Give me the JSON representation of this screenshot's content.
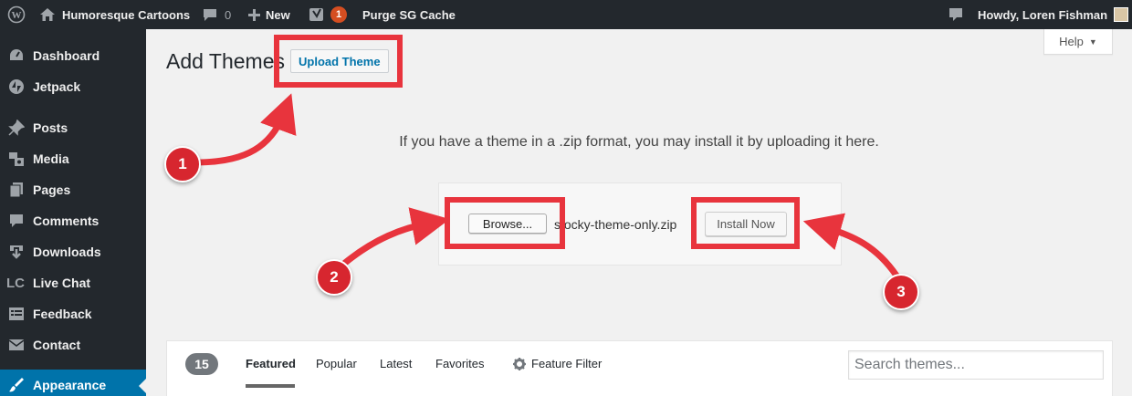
{
  "admin_bar": {
    "site_name": "Humoresque Cartoons",
    "comments_count": "0",
    "new_label": "New",
    "yoast_badge": "1",
    "purge_label": "Purge SG Cache",
    "howdy": "Howdy, Loren Fishman"
  },
  "sidebar": {
    "items": [
      {
        "label": "Dashboard",
        "icon": "dashboard-icon"
      },
      {
        "label": "Jetpack",
        "icon": "jetpack-icon"
      },
      {
        "label": "Posts",
        "icon": "pin-icon"
      },
      {
        "label": "Media",
        "icon": "media-icon"
      },
      {
        "label": "Pages",
        "icon": "pages-icon"
      },
      {
        "label": "Comments",
        "icon": "comment-icon"
      },
      {
        "label": "Downloads",
        "icon": "download-icon"
      },
      {
        "label": "Live Chat",
        "icon": "lc-icon",
        "icon_text": "LC"
      },
      {
        "label": "Feedback",
        "icon": "feedback-icon"
      },
      {
        "label": "Contact",
        "icon": "mail-icon"
      },
      {
        "label": "Appearance",
        "icon": "brush-icon",
        "current": true
      }
    ]
  },
  "help_tab": {
    "label": "Help",
    "caret": "▼"
  },
  "page": {
    "title": "Add Themes",
    "upload_button": "Upload Theme",
    "upload_help": "If you have a theme in a .zip format, you may install it by uploading it here.",
    "browse_button": "Browse...",
    "file_name": "stocky-theme-only.zip",
    "install_button": "Install Now"
  },
  "filter": {
    "count": "15",
    "links": [
      "Featured",
      "Popular",
      "Latest",
      "Favorites"
    ],
    "feature_filter": "Feature Filter",
    "search_placeholder": "Search themes..."
  },
  "annotations": {
    "markers": [
      "1",
      "2",
      "3"
    ],
    "color": "#e8343d"
  },
  "colors": {
    "admin_bg": "#23282d",
    "accent": "#0073aa",
    "badge": "#d54e21"
  }
}
